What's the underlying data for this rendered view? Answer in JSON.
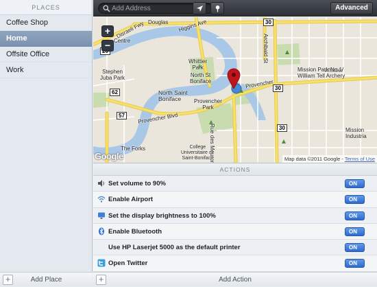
{
  "sidebar": {
    "header": "PLACES",
    "items": [
      {
        "label": "Coffee Shop",
        "selected": false
      },
      {
        "label": "Home",
        "selected": true
      },
      {
        "label": "Offsite Office",
        "selected": false
      },
      {
        "label": "Work",
        "selected": false
      }
    ],
    "footer": {
      "add_icon": "plus-icon",
      "label": "Add Place"
    }
  },
  "toolbar": {
    "search": {
      "icon": "search-icon",
      "placeholder": "Add Address",
      "value": ""
    },
    "location_icon": "location-arrow-icon",
    "pin_icon": "pin-icon",
    "advanced_label": "Advanced"
  },
  "map": {
    "labels": {
      "centre": "Centre",
      "douglas": "Douglas",
      "higgins": "Higgins Ave",
      "whittier_top": "Whittier",
      "whittier_park": "Whittier\nPark",
      "north_st_boniface": "North St\nBoniface",
      "stephen_juba": "Stephen\nJuba Park",
      "north_saint_boniface": "North Saint\nBoniface",
      "provencher_park": "Provencher\nPark",
      "provencher_blvd_1": "Provencher Blvd",
      "provencher_blvd_2": "Provencher",
      "the_forks": "The Forks",
      "college": "College\nUniversitaire de\nSaint-Boniface",
      "rue_des_meurons": "Rue des Meurons",
      "archibald": "Archibald St",
      "mission_park": "Mission Park No 1/\nWilliam Tell Archery",
      "mission_industrial": "Mission\nIndustria",
      "disraeli": "Disraeli Fwy"
    },
    "shields": {
      "s30_top": "30",
      "s30_mid": "30",
      "s30_low": "30",
      "s57": "57",
      "s62": "62",
      "s20": "20"
    },
    "zoom_in": "+",
    "zoom_out": "−",
    "attribution": "Map data ©2011 Google - ",
    "terms": "Terms of Use",
    "google_logo": "Google"
  },
  "actions": {
    "header": "ACTIONS",
    "items": [
      {
        "icon": "speaker-icon",
        "label": "Set volume to 90%",
        "toggle": "ON"
      },
      {
        "icon": "wifi-icon",
        "label": "Enable Airport",
        "toggle": "ON"
      },
      {
        "icon": "display-icon",
        "label": "Set the display brightness to 100%",
        "toggle": "ON"
      },
      {
        "icon": "bluetooth-icon",
        "label": "Enable Bluetooth",
        "toggle": "ON"
      },
      {
        "icon": "",
        "label": "Use HP Laserjet 5000 as the default printer",
        "toggle": "ON"
      },
      {
        "icon": "twitter-icon",
        "label": "Open Twitter",
        "toggle": "ON"
      }
    ],
    "footer": {
      "add_icon": "plus-icon",
      "label": "Add Action"
    }
  },
  "colors": {
    "toggle_on": "#2f6ad0",
    "selection": "#7b92b0",
    "pin": "#c0141c",
    "river": "#a9c7e6",
    "park": "#c9dcb0",
    "road_yellow": "#f7e06b"
  }
}
